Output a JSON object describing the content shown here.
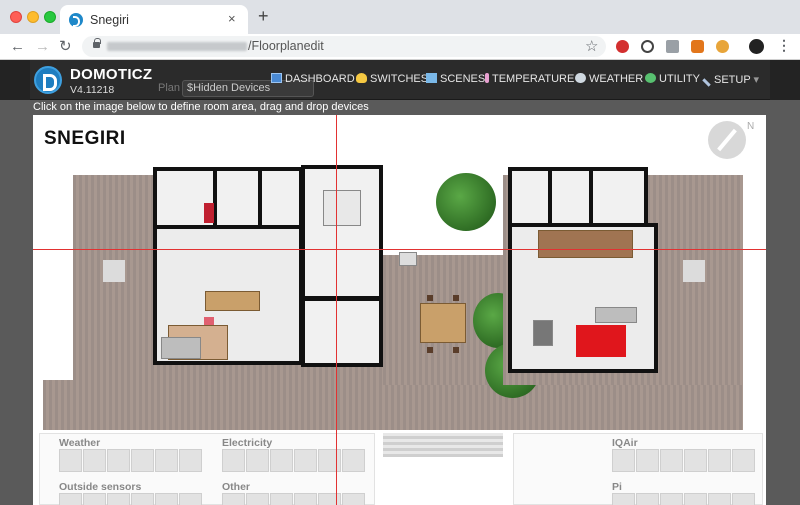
{
  "browser": {
    "tab_title": "Snegiri",
    "tab_close": "×",
    "new_tab": "+",
    "url_path": "/Floorplanedit",
    "back": "←",
    "forward": "→",
    "reload": "↻",
    "star": "☆",
    "menu": "⋮"
  },
  "app": {
    "brand": "DOMOTICZ",
    "version": "V4.11218",
    "plan_label": "Plan",
    "plan_selected": "$Hidden Devices",
    "nav": [
      {
        "label": "DASHBOARD",
        "icon": "dashboard-icon",
        "color": "#4a8ad4"
      },
      {
        "label": "SWITCHES",
        "icon": "lightbulb-icon",
        "color": "#f5c842"
      },
      {
        "label": "SCENES",
        "icon": "scenes-icon",
        "color": "#7ab8e8"
      },
      {
        "label": "TEMPERATURE",
        "icon": "thermometer-icon",
        "color": "#e8a0d0"
      },
      {
        "label": "WEATHER",
        "icon": "cloud-icon",
        "color": "#cfd8e0"
      },
      {
        "label": "UTILITY",
        "icon": "utility-icon",
        "color": "#58c070"
      },
      {
        "label": "SETUP",
        "icon": "tools-icon",
        "color": "#b0c4de"
      }
    ]
  },
  "hint": "Click on the image below to define room area, drag and drop devices",
  "floorplan": {
    "title": "SNEGIRI",
    "compass_label": "N"
  },
  "device_groups": [
    {
      "label": "Weather"
    },
    {
      "label": "Electricity"
    },
    {
      "label": "IQAir"
    },
    {
      "label": "Outside sensors"
    },
    {
      "label": "Other"
    },
    {
      "label": "Pi"
    }
  ]
}
